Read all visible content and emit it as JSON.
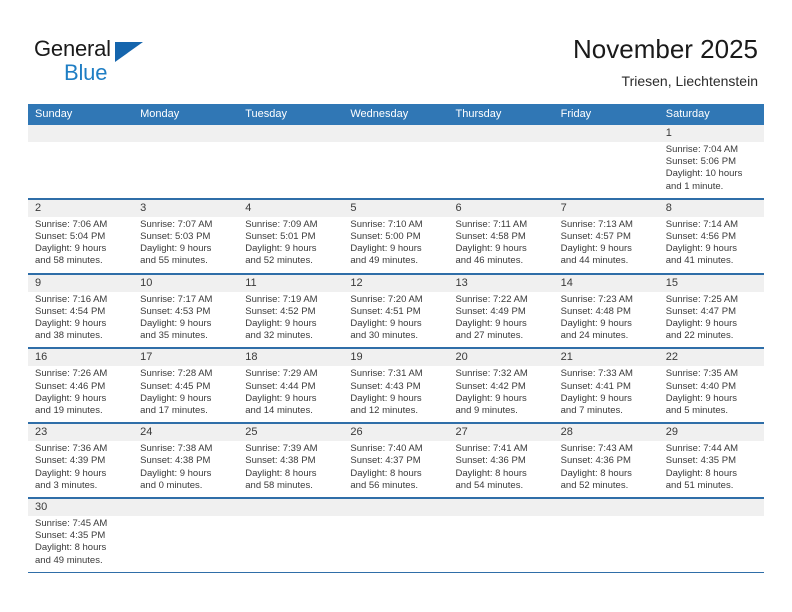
{
  "brand": {
    "name_top": "General",
    "name_bottom": "Blue",
    "triangle_color": "#1565ad",
    "blue_color": "#1f7ec4"
  },
  "header": {
    "title": "November 2025",
    "location": "Triesen, Liechtenstein"
  },
  "theme": {
    "header_blue": "#3077b5",
    "rule_blue": "#2f6ea8",
    "daynum_band": "#f0f0f0",
    "text": "#3a3a3a"
  },
  "calendar": {
    "day_names": [
      "Sunday",
      "Monday",
      "Tuesday",
      "Wednesday",
      "Thursday",
      "Friday",
      "Saturday"
    ],
    "weeks": [
      [
        {
          "day": "",
          "lines": []
        },
        {
          "day": "",
          "lines": []
        },
        {
          "day": "",
          "lines": []
        },
        {
          "day": "",
          "lines": []
        },
        {
          "day": "",
          "lines": []
        },
        {
          "day": "",
          "lines": []
        },
        {
          "day": "1",
          "lines": [
            "Sunrise: 7:04 AM",
            "Sunset: 5:06 PM",
            "Daylight: 10 hours",
            "and 1 minute."
          ]
        }
      ],
      [
        {
          "day": "2",
          "lines": [
            "Sunrise: 7:06 AM",
            "Sunset: 5:04 PM",
            "Daylight: 9 hours",
            "and 58 minutes."
          ]
        },
        {
          "day": "3",
          "lines": [
            "Sunrise: 7:07 AM",
            "Sunset: 5:03 PM",
            "Daylight: 9 hours",
            "and 55 minutes."
          ]
        },
        {
          "day": "4",
          "lines": [
            "Sunrise: 7:09 AM",
            "Sunset: 5:01 PM",
            "Daylight: 9 hours",
            "and 52 minutes."
          ]
        },
        {
          "day": "5",
          "lines": [
            "Sunrise: 7:10 AM",
            "Sunset: 5:00 PM",
            "Daylight: 9 hours",
            "and 49 minutes."
          ]
        },
        {
          "day": "6",
          "lines": [
            "Sunrise: 7:11 AM",
            "Sunset: 4:58 PM",
            "Daylight: 9 hours",
            "and 46 minutes."
          ]
        },
        {
          "day": "7",
          "lines": [
            "Sunrise: 7:13 AM",
            "Sunset: 4:57 PM",
            "Daylight: 9 hours",
            "and 44 minutes."
          ]
        },
        {
          "day": "8",
          "lines": [
            "Sunrise: 7:14 AM",
            "Sunset: 4:56 PM",
            "Daylight: 9 hours",
            "and 41 minutes."
          ]
        }
      ],
      [
        {
          "day": "9",
          "lines": [
            "Sunrise: 7:16 AM",
            "Sunset: 4:54 PM",
            "Daylight: 9 hours",
            "and 38 minutes."
          ]
        },
        {
          "day": "10",
          "lines": [
            "Sunrise: 7:17 AM",
            "Sunset: 4:53 PM",
            "Daylight: 9 hours",
            "and 35 minutes."
          ]
        },
        {
          "day": "11",
          "lines": [
            "Sunrise: 7:19 AM",
            "Sunset: 4:52 PM",
            "Daylight: 9 hours",
            "and 32 minutes."
          ]
        },
        {
          "day": "12",
          "lines": [
            "Sunrise: 7:20 AM",
            "Sunset: 4:51 PM",
            "Daylight: 9 hours",
            "and 30 minutes."
          ]
        },
        {
          "day": "13",
          "lines": [
            "Sunrise: 7:22 AM",
            "Sunset: 4:49 PM",
            "Daylight: 9 hours",
            "and 27 minutes."
          ]
        },
        {
          "day": "14",
          "lines": [
            "Sunrise: 7:23 AM",
            "Sunset: 4:48 PM",
            "Daylight: 9 hours",
            "and 24 minutes."
          ]
        },
        {
          "day": "15",
          "lines": [
            "Sunrise: 7:25 AM",
            "Sunset: 4:47 PM",
            "Daylight: 9 hours",
            "and 22 minutes."
          ]
        }
      ],
      [
        {
          "day": "16",
          "lines": [
            "Sunrise: 7:26 AM",
            "Sunset: 4:46 PM",
            "Daylight: 9 hours",
            "and 19 minutes."
          ]
        },
        {
          "day": "17",
          "lines": [
            "Sunrise: 7:28 AM",
            "Sunset: 4:45 PM",
            "Daylight: 9 hours",
            "and 17 minutes."
          ]
        },
        {
          "day": "18",
          "lines": [
            "Sunrise: 7:29 AM",
            "Sunset: 4:44 PM",
            "Daylight: 9 hours",
            "and 14 minutes."
          ]
        },
        {
          "day": "19",
          "lines": [
            "Sunrise: 7:31 AM",
            "Sunset: 4:43 PM",
            "Daylight: 9 hours",
            "and 12 minutes."
          ]
        },
        {
          "day": "20",
          "lines": [
            "Sunrise: 7:32 AM",
            "Sunset: 4:42 PM",
            "Daylight: 9 hours",
            "and 9 minutes."
          ]
        },
        {
          "day": "21",
          "lines": [
            "Sunrise: 7:33 AM",
            "Sunset: 4:41 PM",
            "Daylight: 9 hours",
            "and 7 minutes."
          ]
        },
        {
          "day": "22",
          "lines": [
            "Sunrise: 7:35 AM",
            "Sunset: 4:40 PM",
            "Daylight: 9 hours",
            "and 5 minutes."
          ]
        }
      ],
      [
        {
          "day": "23",
          "lines": [
            "Sunrise: 7:36 AM",
            "Sunset: 4:39 PM",
            "Daylight: 9 hours",
            "and 3 minutes."
          ]
        },
        {
          "day": "24",
          "lines": [
            "Sunrise: 7:38 AM",
            "Sunset: 4:38 PM",
            "Daylight: 9 hours",
            "and 0 minutes."
          ]
        },
        {
          "day": "25",
          "lines": [
            "Sunrise: 7:39 AM",
            "Sunset: 4:38 PM",
            "Daylight: 8 hours",
            "and 58 minutes."
          ]
        },
        {
          "day": "26",
          "lines": [
            "Sunrise: 7:40 AM",
            "Sunset: 4:37 PM",
            "Daylight: 8 hours",
            "and 56 minutes."
          ]
        },
        {
          "day": "27",
          "lines": [
            "Sunrise: 7:41 AM",
            "Sunset: 4:36 PM",
            "Daylight: 8 hours",
            "and 54 minutes."
          ]
        },
        {
          "day": "28",
          "lines": [
            "Sunrise: 7:43 AM",
            "Sunset: 4:36 PM",
            "Daylight: 8 hours",
            "and 52 minutes."
          ]
        },
        {
          "day": "29",
          "lines": [
            "Sunrise: 7:44 AM",
            "Sunset: 4:35 PM",
            "Daylight: 8 hours",
            "and 51 minutes."
          ]
        }
      ],
      [
        {
          "day": "30",
          "lines": [
            "Sunrise: 7:45 AM",
            "Sunset: 4:35 PM",
            "Daylight: 8 hours",
            "and 49 minutes."
          ]
        },
        {
          "day": "",
          "lines": []
        },
        {
          "day": "",
          "lines": []
        },
        {
          "day": "",
          "lines": []
        },
        {
          "day": "",
          "lines": []
        },
        {
          "day": "",
          "lines": []
        },
        {
          "day": "",
          "lines": []
        }
      ]
    ]
  }
}
